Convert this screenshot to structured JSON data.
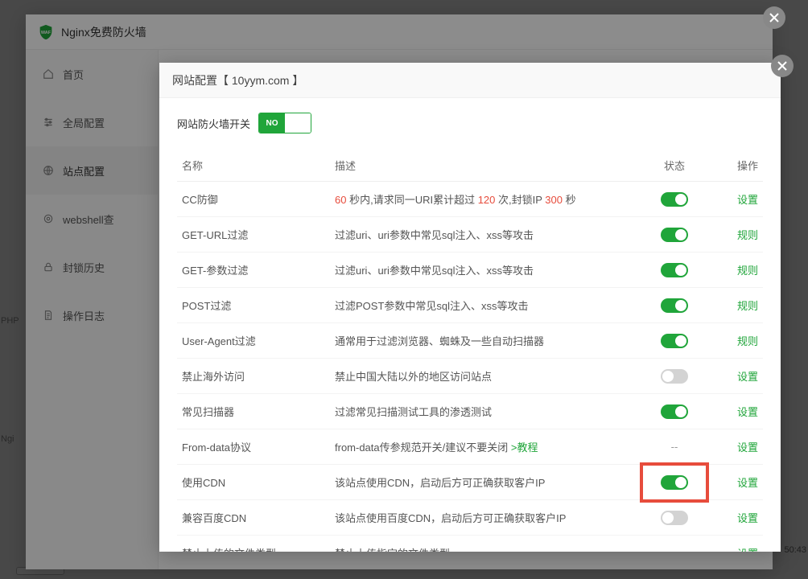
{
  "outer": {
    "title": "Nginx免费防火墙",
    "sidebar": [
      {
        "label": "首页"
      },
      {
        "label": "全局配置"
      },
      {
        "label": "站点配置"
      },
      {
        "label": "webshell查"
      },
      {
        "label": "封锁历史"
      },
      {
        "label": "操作日志"
      }
    ]
  },
  "inner": {
    "title": "网站配置【 10yym.com 】",
    "firewall_switch_label": "网站防火墙开关",
    "switch_on_text": "NO",
    "table_headers": {
      "name": "名称",
      "desc": "描述",
      "status": "状态",
      "action": "操作"
    },
    "rows": [
      {
        "name": "CC防御",
        "desc_parts": [
          {
            "t": "60",
            "red": true
          },
          {
            "t": " 秒内,请求同一URI累计超过 "
          },
          {
            "t": "120",
            "red": true
          },
          {
            "t": " 次,封锁IP "
          },
          {
            "t": "300",
            "red": true
          },
          {
            "t": " 秒"
          }
        ],
        "status": "on",
        "action": "设置"
      },
      {
        "name": "GET-URL过滤",
        "desc": "过滤uri、uri参数中常见sql注入、xss等攻击",
        "status": "on",
        "action": "规则"
      },
      {
        "name": "GET-参数过滤",
        "desc": "过滤uri、uri参数中常见sql注入、xss等攻击",
        "status": "on",
        "action": "规则"
      },
      {
        "name": "POST过滤",
        "desc": "过滤POST参数中常见sql注入、xss等攻击",
        "status": "on",
        "action": "规则"
      },
      {
        "name": "User-Agent过滤",
        "desc": "通常用于过滤浏览器、蜘蛛及一些自动扫描器",
        "status": "on",
        "action": "规则"
      },
      {
        "name": "禁止海外访问",
        "desc": "禁止中国大陆以外的地区访问站点",
        "status": "off",
        "action": "设置"
      },
      {
        "name": "常见扫描器",
        "desc": "过滤常见扫描测试工具的渗透测试",
        "status": "on",
        "action": "设置"
      },
      {
        "name": "From-data协议",
        "desc_parts": [
          {
            "t": "from-data传参规范开关/建议不要关闭 "
          },
          {
            "t": ">教程",
            "link": true
          }
        ],
        "status": "dash",
        "action": "设置"
      },
      {
        "name": "使用CDN",
        "desc": "该站点使用CDN，启动后方可正确获取客户IP",
        "status": "on",
        "action": "设置",
        "highlight": true
      },
      {
        "name": "兼容百度CDN",
        "desc": "该站点使用百度CDN，启动后方可正确获取客户IP",
        "status": "off",
        "action": "设置"
      },
      {
        "name": "禁止上传的文件类型",
        "desc": "禁止上传指定的文件类型",
        "status": "dash",
        "action": "设置"
      }
    ]
  },
  "bg": {
    "php_text": "PHP",
    "ngi_text": "Ngi",
    "clock": "50:43"
  }
}
